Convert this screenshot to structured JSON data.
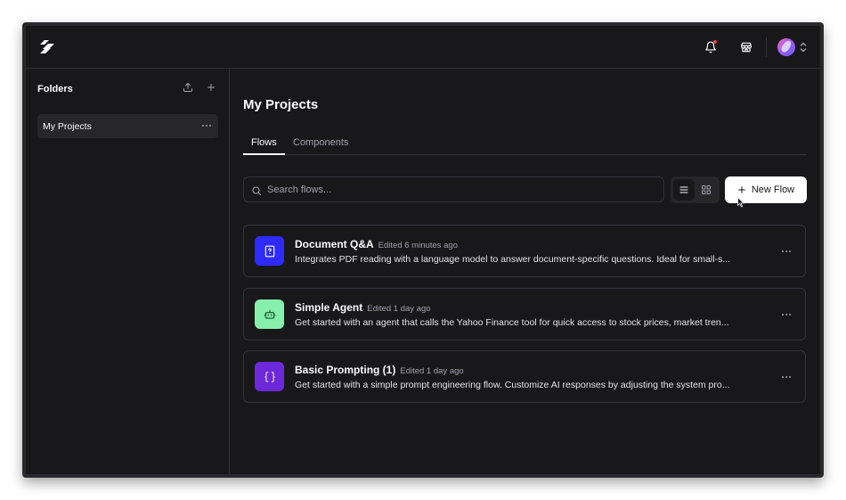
{
  "colors": {
    "background": "#18181b",
    "panel_active": "#27272a",
    "border": "#34343a",
    "doc_icon_bg": "#2f2bff",
    "agent_icon_bg": "#86efac",
    "prompt_icon_bg": "#6d28d9",
    "notification_dot": "#ef4444"
  },
  "header": {
    "logo_icon": "langflow-logo-icon",
    "notifications_icon": "bell-icon",
    "store_icon": "store-icon",
    "avatar_icon": "avatar",
    "menu_chevron_icon": "chevron-updown-icon"
  },
  "sidebar": {
    "title": "Folders",
    "upload_icon": "upload-icon",
    "add_icon": "plus-icon",
    "folders": [
      {
        "label": "My Projects",
        "active": true
      }
    ]
  },
  "main": {
    "title": "My Projects",
    "tabs": [
      {
        "label": "Flows",
        "active": true
      },
      {
        "label": "Components",
        "active": false
      }
    ],
    "search": {
      "placeholder": "Search flows...",
      "value": ""
    },
    "view_modes": [
      "list",
      "grid"
    ],
    "active_view": "list",
    "new_flow_label": "New Flow",
    "flows": [
      {
        "title": "Document Q&A",
        "edited": "Edited 6 minutes ago",
        "description": "Integrates PDF reading with a language model to answer document-specific questions. Ideal for small-s...",
        "icon": "file-question-icon"
      },
      {
        "title": "Simple Agent",
        "edited": "Edited 1 day ago",
        "description": "Get started with an agent that calls the Yahoo Finance tool for quick access to stock prices, market tren...",
        "icon": "bot-icon"
      },
      {
        "title": "Basic Prompting (1)",
        "edited": "Edited 1 day ago",
        "description": "Get started with a simple prompt engineering flow. Customize AI responses by adjusting the system pro...",
        "icon": "braces-icon"
      }
    ]
  }
}
